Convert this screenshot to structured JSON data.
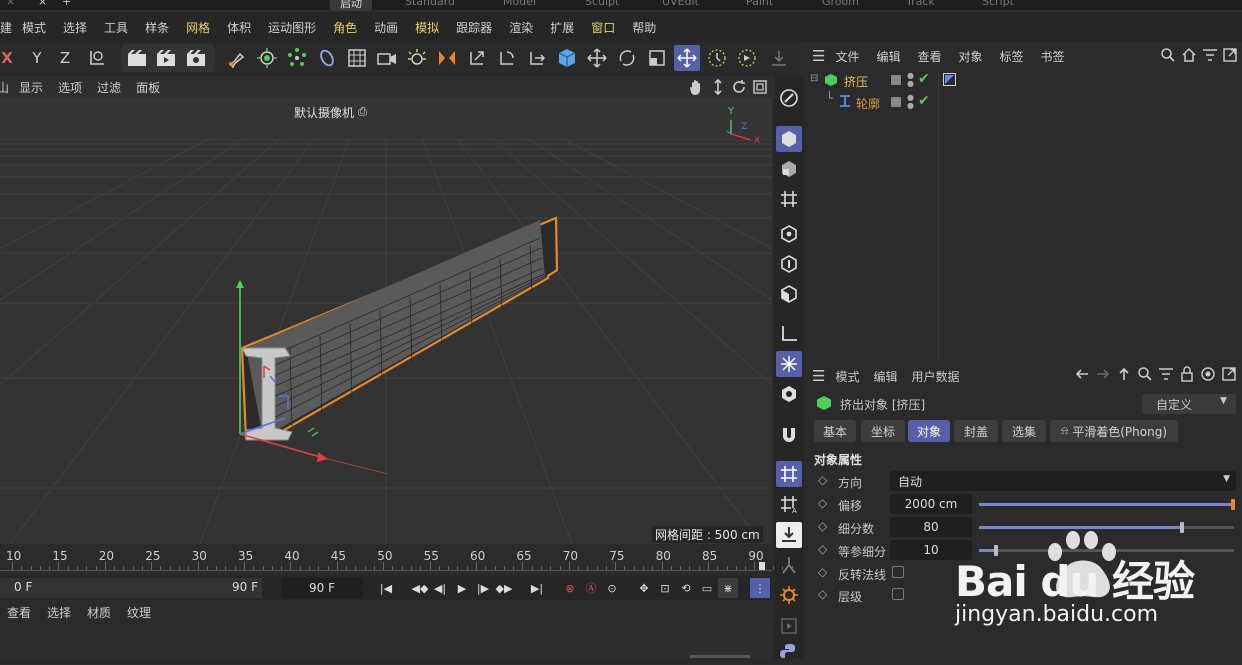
{
  "tabs": [
    "启动",
    "Standard",
    "Model",
    "Sculpt",
    "UVEdit",
    "Paint",
    "Groom",
    "Track",
    "Script"
  ],
  "menu": [
    "建",
    "模式",
    "选择",
    "工具",
    "样条",
    "网格",
    "体积",
    "运动图形",
    "角色",
    "动画",
    "模拟",
    "跟踪器",
    "渲染",
    "扩展",
    "窗口",
    "帮助"
  ],
  "axes": {
    "x": "X",
    "y": "Y",
    "z": "Z"
  },
  "viewport_menu": [
    "山",
    "显示",
    "选项",
    "过滤",
    "面板"
  ],
  "camera_label": "默认摄像机",
  "grid_spacing": "网格间距 : 500 cm",
  "gizmo": {
    "y": "Y",
    "z": "Z",
    "x": "X"
  },
  "ruler_ticks": [
    "10",
    "15",
    "20",
    "25",
    "30",
    "35",
    "40",
    "45",
    "50",
    "55",
    "60",
    "65",
    "70",
    "75",
    "80",
    "85",
    "90"
  ],
  "transport": {
    "start": "0 F",
    "end": "90 F",
    "current": "90 F"
  },
  "material_menu": [
    "查看",
    "选择",
    "材质",
    "纹理"
  ],
  "object_manager": {
    "menu": [
      "文件",
      "编辑",
      "查看",
      "对象",
      "标签",
      "书签"
    ],
    "objects": [
      {
        "name": "挤压",
        "color": "#e7c25a"
      },
      {
        "name": "轮廓",
        "color": "#e39a3f"
      }
    ]
  },
  "attributes": {
    "menu": [
      "模式",
      "编辑",
      "用户数据"
    ],
    "title": "挤出对象 [挤压]",
    "preset": "自定义",
    "tabs": [
      "基本",
      "坐标",
      "对象",
      "封盖",
      "选集",
      "平滑着色(Phong)"
    ],
    "active_tab": "对象",
    "section": "对象属性",
    "props": [
      {
        "label": "方向",
        "value": "自动"
      },
      {
        "label": "偏移",
        "value": "2000 cm",
        "fraction": 1.0
      },
      {
        "label": "细分数",
        "value": "80",
        "fraction": 0.8
      },
      {
        "label": "等参细分",
        "value": "10",
        "fraction": 0.07
      },
      {
        "label": "反转法线"
      },
      {
        "label": "层级"
      }
    ]
  },
  "watermark": {
    "brand": "Bai du 经验",
    "url": "jingyan.baidu.com"
  },
  "colors": {
    "accent": "#5560a8",
    "object_outline": "#e8862a",
    "check": "#4fce5d"
  }
}
